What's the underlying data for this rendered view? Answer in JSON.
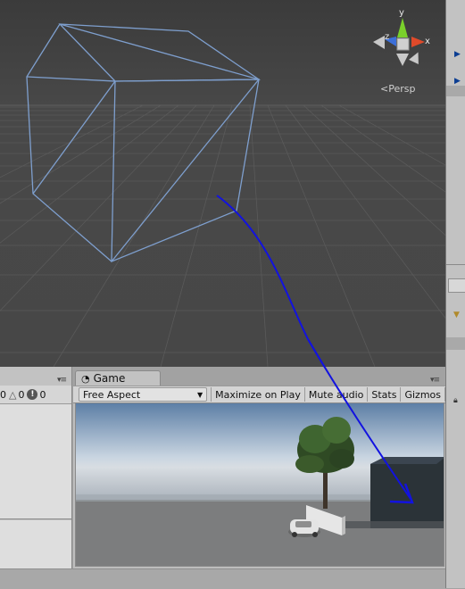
{
  "scene": {
    "projection_label": "Persp",
    "gizmo_axes": {
      "x": "x",
      "y": "y",
      "z": "z"
    }
  },
  "console_toolbar": {
    "info_count": "0",
    "warning_count": "0",
    "error_count": "0"
  },
  "game": {
    "tab_label": "Game",
    "aspect_selected": "Free Aspect",
    "maximize_on_play": "Maximize on Play",
    "mute_audio": "Mute audio",
    "stats": "Stats",
    "gizmos": "Gizmos"
  },
  "colors": {
    "scene_bg": "#474747",
    "camera_frustum": "#7e9fce",
    "annotation_arrow": "#1212e0",
    "gizmo_x": "#e04a2a",
    "gizmo_y": "#7ad02b",
    "gizmo_z": "#3c6fd8"
  },
  "icons": {
    "game_tab": "game-controller-icon",
    "panel_menu": "panel-menu-icon",
    "orientation_gizmo": "scene-orientation-gizmo",
    "persp_toggle": "perspective-icon"
  }
}
